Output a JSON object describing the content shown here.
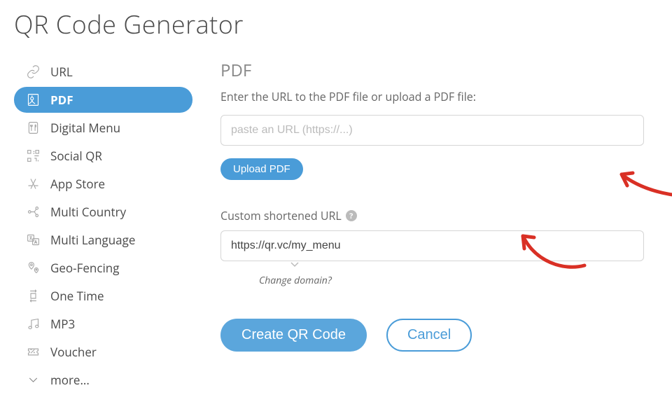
{
  "page_title": "QR Code Generator",
  "sidebar": {
    "items": [
      {
        "label": "URL",
        "icon": "link-icon",
        "active": false
      },
      {
        "label": "PDF",
        "icon": "pdf-icon",
        "active": true
      },
      {
        "label": "Digital Menu",
        "icon": "menu-icon",
        "active": false
      },
      {
        "label": "Social QR",
        "icon": "social-icon",
        "active": false
      },
      {
        "label": "App Store",
        "icon": "appstore-icon",
        "active": false
      },
      {
        "label": "Multi Country",
        "icon": "multicountry-icon",
        "active": false
      },
      {
        "label": "Multi Language",
        "icon": "multilanguage-icon",
        "active": false
      },
      {
        "label": "Geo-Fencing",
        "icon": "geofencing-icon",
        "active": false
      },
      {
        "label": "One Time",
        "icon": "onetime-icon",
        "active": false
      },
      {
        "label": "MP3",
        "icon": "mp3-icon",
        "active": false
      },
      {
        "label": "Voucher",
        "icon": "voucher-icon",
        "active": false
      },
      {
        "label": "more...",
        "icon": "chevron-down-icon",
        "active": false
      }
    ]
  },
  "main": {
    "section_title": "PDF",
    "helper_text": "Enter the URL to the PDF file or upload a PDF file:",
    "url_input_placeholder": "paste an URL (https://...)",
    "upload_button": "Upload PDF",
    "custom_url_label": "Custom shortened URL",
    "custom_url_value": "https://qr.vc/my_menu",
    "change_domain_text": "Change domain?",
    "create_button": "Create QR Code",
    "cancel_button": "Cancel"
  },
  "annotations": {
    "arrow_color": "#d93025"
  }
}
